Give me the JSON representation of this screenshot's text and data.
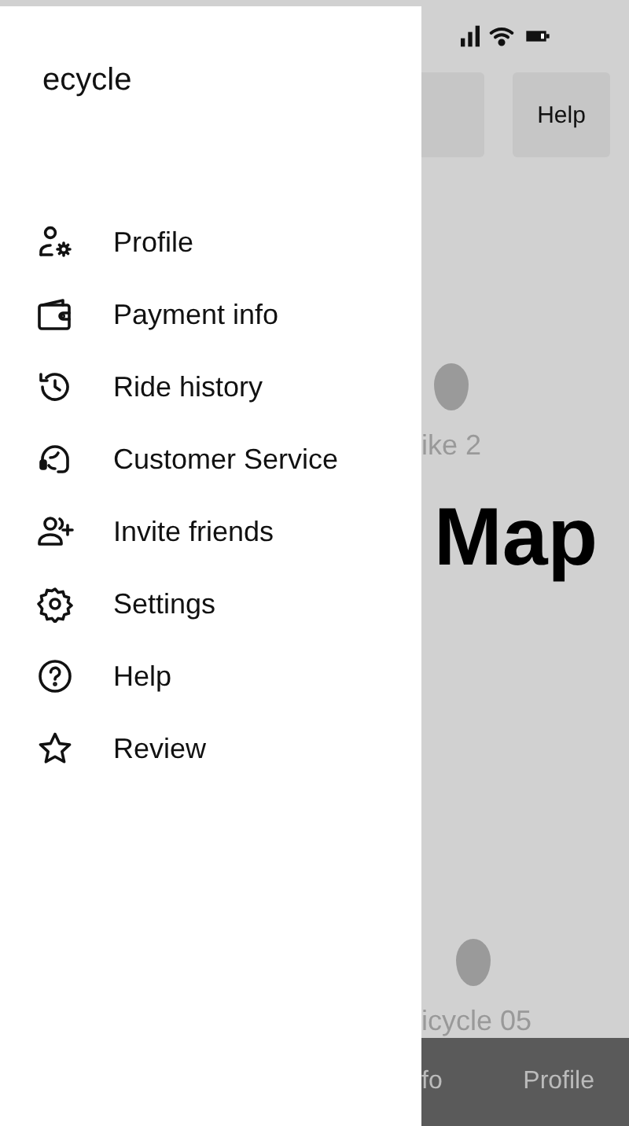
{
  "drawer": {
    "title": "ecycle",
    "items": [
      {
        "label": "Profile"
      },
      {
        "label": "Payment info"
      },
      {
        "label": "Ride history"
      },
      {
        "label": "Customer Service"
      },
      {
        "label": "Invite friends"
      },
      {
        "label": "Settings"
      },
      {
        "label": "Help"
      },
      {
        "label": "Review"
      }
    ]
  },
  "map": {
    "title": "Map",
    "buttons": [
      {
        "kind": "blank"
      },
      {
        "kind": "text",
        "label": "Help"
      }
    ],
    "bikes": [
      {
        "label": "ike 2"
      },
      {
        "label": "icycle 05"
      }
    ]
  },
  "bottom_nav": [
    "fo",
    "Profile"
  ]
}
